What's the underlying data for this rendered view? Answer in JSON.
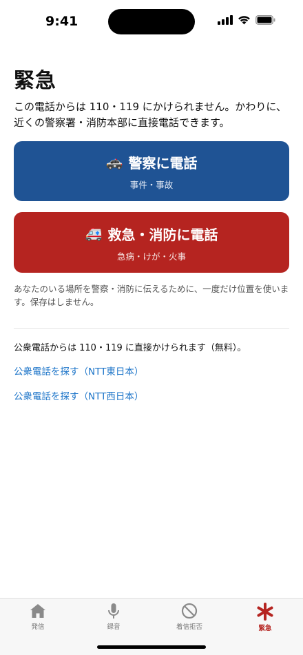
{
  "status_bar": {
    "time": "9:41"
  },
  "header": {
    "title": "緊急"
  },
  "description": "この電話からは 110・119 にかけられません。かわりに、近くの警察署・消防本部に直接電話できます。",
  "buttons": {
    "police": {
      "emoji": "🚓",
      "label": "警察に電話",
      "sub": "事件・事故",
      "color": "#1f5394"
    },
    "fire": {
      "emoji": "🚑",
      "label": "救急・消防に電話",
      "sub": "急病・けが・火事",
      "color": "#b52420"
    }
  },
  "privacy_note": "あなたのいる場所を警察・消防に伝えるために、一度だけ位置を使います。保存はしません。",
  "payphone": {
    "note": "公衆電話からは 110・119 に直接かけられます（無料）。",
    "link_east": "公衆電話を探す（NTT東日本）",
    "link_west": "公衆電話を探す（NTT西日本）",
    "link_color": "#1a73c8"
  },
  "tabs": [
    {
      "label": "発信",
      "icon": "house-icon"
    },
    {
      "label": "録音",
      "icon": "microphone-icon"
    },
    {
      "label": "着信拒否",
      "icon": "prohibited-icon"
    },
    {
      "label": "緊急",
      "icon": "asterisk-icon",
      "active": true
    }
  ]
}
